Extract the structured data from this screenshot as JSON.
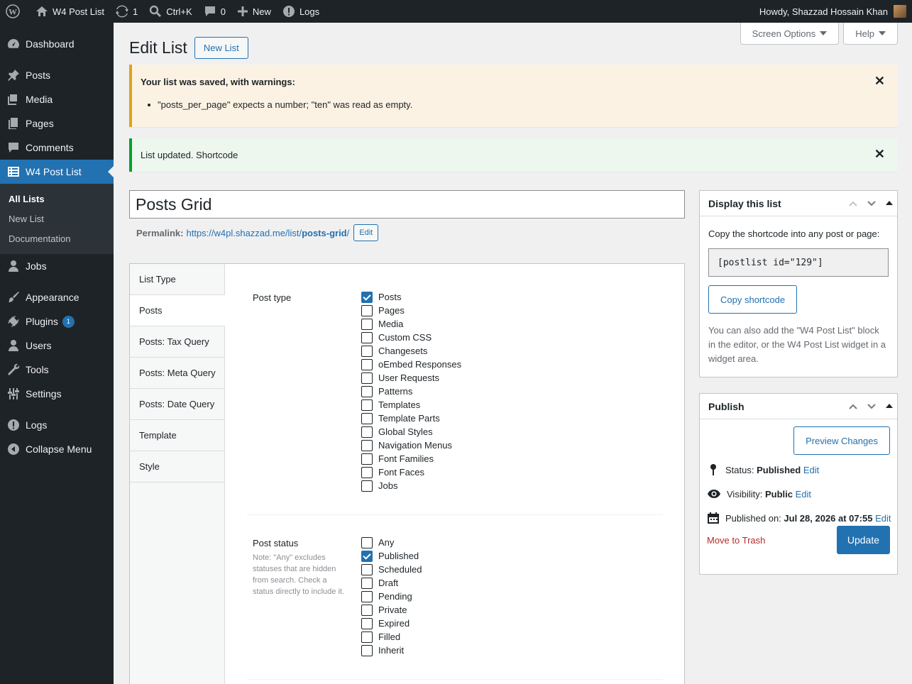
{
  "adminbar": {
    "site_name": "W4 Post List",
    "updates": "1",
    "search_shortcut": "Ctrl+K",
    "comments": "0",
    "new_label": "New",
    "logs_label": "Logs",
    "howdy": "Howdy, Shazzad Hossain Khan"
  },
  "sidebar": {
    "items": [
      {
        "label": "Dashboard"
      },
      {
        "label": "Posts"
      },
      {
        "label": "Media"
      },
      {
        "label": "Pages"
      },
      {
        "label": "Comments"
      },
      {
        "label": "W4 Post List"
      }
    ],
    "submenu": [
      "All Lists",
      "New List",
      "Documentation"
    ],
    "items2": [
      {
        "label": "Jobs"
      },
      {
        "label": "Appearance"
      },
      {
        "label": "Plugins",
        "badge": "1"
      },
      {
        "label": "Users"
      },
      {
        "label": "Tools"
      },
      {
        "label": "Settings"
      },
      {
        "label": "Logs"
      },
      {
        "label": "Collapse Menu"
      }
    ]
  },
  "screen_options": "Screen Options",
  "help": "Help",
  "page_title": "Edit List",
  "new_list_button": "New List",
  "notice_warning": {
    "title": "Your list was saved, with warnings:",
    "item": "\"posts_per_page\" expects a number; \"ten\" was read as empty."
  },
  "notice_success": "List updated. Shortcode",
  "post_title": "Posts Grid",
  "permalink": {
    "label": "Permalink:",
    "url_base": "https://w4pl.shazzad.me/list/",
    "slug": "posts-grid",
    "slash": "/",
    "edit": "Edit"
  },
  "tabs": [
    "List Type",
    "Posts",
    "Posts: Tax Query",
    "Posts: Meta Query",
    "Posts: Date Query",
    "Template",
    "Style"
  ],
  "post_type": {
    "label": "Post type",
    "options": [
      {
        "label": "Posts",
        "checked": true
      },
      {
        "label": "Pages",
        "checked": false
      },
      {
        "label": "Media",
        "checked": false
      },
      {
        "label": "Custom CSS",
        "checked": false
      },
      {
        "label": "Changesets",
        "checked": false
      },
      {
        "label": "oEmbed Responses",
        "checked": false
      },
      {
        "label": "User Requests",
        "checked": false
      },
      {
        "label": "Patterns",
        "checked": false
      },
      {
        "label": "Templates",
        "checked": false
      },
      {
        "label": "Template Parts",
        "checked": false
      },
      {
        "label": "Global Styles",
        "checked": false
      },
      {
        "label": "Navigation Menus",
        "checked": false
      },
      {
        "label": "Font Families",
        "checked": false
      },
      {
        "label": "Font Faces",
        "checked": false
      },
      {
        "label": "Jobs",
        "checked": false
      }
    ]
  },
  "post_status": {
    "label": "Post status",
    "note": "Note: \"Any\" excludes statuses that are hidden from search. Check a status directly to include it.",
    "options": [
      {
        "label": "Any",
        "checked": false
      },
      {
        "label": "Published",
        "checked": true
      },
      {
        "label": "Scheduled",
        "checked": false
      },
      {
        "label": "Draft",
        "checked": false
      },
      {
        "label": "Pending",
        "checked": false
      },
      {
        "label": "Private",
        "checked": false
      },
      {
        "label": "Expired",
        "checked": false
      },
      {
        "label": "Filled",
        "checked": false
      },
      {
        "label": "Inherit",
        "checked": false
      }
    ]
  },
  "display_box": {
    "title": "Display this list",
    "intro": "Copy the shortcode into any post or page:",
    "shortcode": "[postlist id=\"129\"]",
    "copy_button": "Copy shortcode",
    "hint": "You can also add the \"W4 Post List\" block in the editor, or the W4 Post List widget in a widget area."
  },
  "publish_box": {
    "title": "Publish",
    "preview": "Preview Changes",
    "status_label": "Status:",
    "status": "Published",
    "visibility_label": "Visibility:",
    "visibility": "Public",
    "published_label": "Published on:",
    "published": "Jul 28, 2026 at 07:55",
    "edit": "Edit",
    "trash": "Move to Trash",
    "update": "Update"
  }
}
